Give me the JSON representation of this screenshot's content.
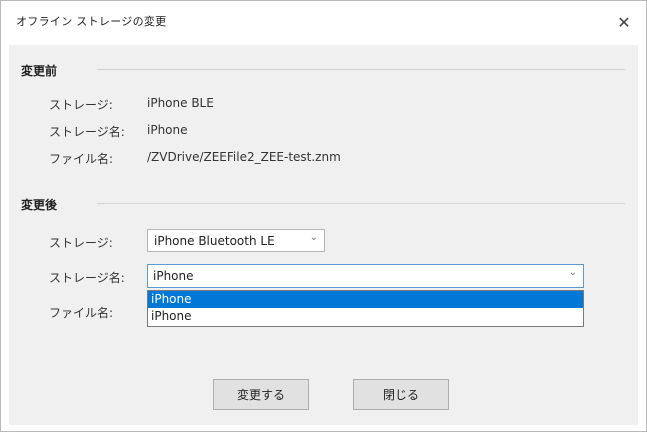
{
  "dialog": {
    "title": "オフライン ストレージの変更",
    "close_glyph": "✕"
  },
  "before": {
    "heading": "変更前",
    "storage_label": "ストレージ:",
    "storage_value": "iPhone BLE",
    "storage_name_label": "ストレージ名:",
    "storage_name_value": "iPhone",
    "file_name_label": "ファイル名:",
    "file_name_value": "/ZVDrive/ZEEFile2_ZEE-test.znm"
  },
  "after": {
    "heading": "変更後",
    "storage_label": "ストレージ:",
    "storage_select_value": "iPhone Bluetooth LE",
    "storage_name_label": "ストレージ名:",
    "storage_name_select_value": "iPhone",
    "storage_name_options": [
      "iPhone",
      "iPhone"
    ],
    "file_name_label": "ファイル名:"
  },
  "buttons": {
    "apply": "変更する",
    "close": "閉じる"
  },
  "icons": {
    "dropdown": "chevron-down-icon",
    "close": "close-icon"
  },
  "colors": {
    "selection": "#0078d7",
    "focus_border": "#5a9bd5",
    "client_bg": "#f0f0f0"
  }
}
